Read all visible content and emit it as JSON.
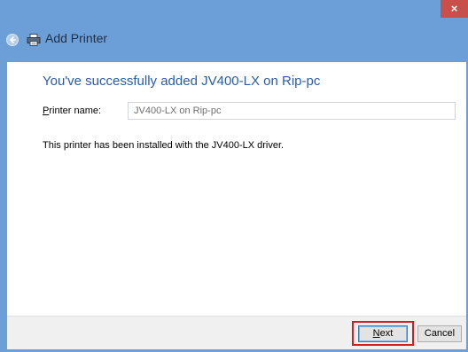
{
  "window": {
    "close_glyph": "×",
    "title_bar_color": "#6c9fd8",
    "close_button_color": "#c7504b"
  },
  "header": {
    "back_icon": "back-arrow-icon",
    "printer_icon": "printer-icon",
    "title": "Add Printer"
  },
  "main": {
    "heading": "You've successfully added JV400-LX on Rip-pc",
    "printer_name_label_accel": "P",
    "printer_name_label_rest": "rinter name:",
    "printer_name_value": "JV400-LX on Rip-pc",
    "info": "This printer has been installed with the JV400-LX driver."
  },
  "footer": {
    "next_label_accel": "N",
    "next_label_rest": "ext",
    "cancel_label": "Cancel",
    "highlight_color": "#d01e24"
  }
}
